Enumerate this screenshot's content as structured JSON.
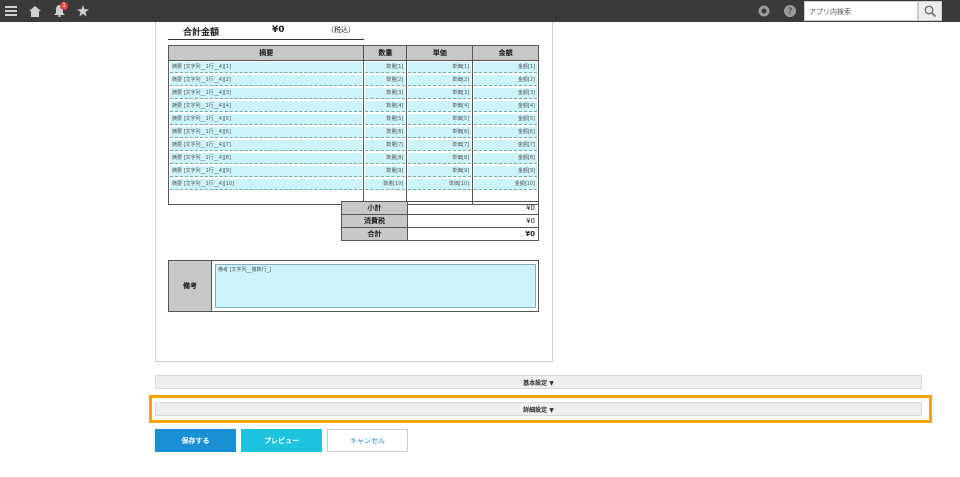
{
  "topbar": {
    "search_placeholder": "アプリ内検索",
    "notification_count": "1",
    "icons": [
      "menu-icon",
      "home-icon",
      "bell-icon",
      "star-icon",
      "gear-icon",
      "help-icon",
      "search-icon"
    ]
  },
  "form": {
    "total_label": "合計金額",
    "total_value": "¥0",
    "tax_included": "（税込）",
    "headers": [
      "摘要",
      "数量",
      "単価",
      "金額"
    ],
    "rows": [
      {
        "desc": "摘要 [文字列__1行__4][1]",
        "qty": "数量[1]",
        "price": "単価[1]",
        "amount": "金額[1]"
      },
      {
        "desc": "摘要 [文字列__1行__4][2]",
        "qty": "数量[2]",
        "price": "単価[2]",
        "amount": "金額[2]"
      },
      {
        "desc": "摘要 [文字列__1行__4][3]",
        "qty": "数量[3]",
        "price": "単価[3]",
        "amount": "金額[3]"
      },
      {
        "desc": "摘要 [文字列__1行__4][4]",
        "qty": "数量[4]",
        "price": "単価[4]",
        "amount": "金額[4]"
      },
      {
        "desc": "摘要 [文字列__1行__4][5]",
        "qty": "数量[5]",
        "price": "単価[5]",
        "amount": "金額[5]"
      },
      {
        "desc": "摘要 [文字列__1行__4][6]",
        "qty": "数量[6]",
        "price": "単価[6]",
        "amount": "金額[6]"
      },
      {
        "desc": "摘要 [文字列__1行__4][7]",
        "qty": "数量[7]",
        "price": "単価[7]",
        "amount": "金額[7]"
      },
      {
        "desc": "摘要 [文字列__1行__4][8]",
        "qty": "数量[8]",
        "price": "単価[8]",
        "amount": "金額[8]"
      },
      {
        "desc": "摘要 [文字列__1行__4][9]",
        "qty": "数量[9]",
        "price": "単価[9]",
        "amount": "金額[9]"
      },
      {
        "desc": "摘要 [文字列__1行__4][10]",
        "qty": "数量[10]",
        "price": "単価[10]",
        "amount": "金額[10]"
      }
    ],
    "subtotal_label": "小計",
    "subtotal_value": "¥0",
    "tax_label": "消費税",
    "tax_value": "¥0",
    "grand_label": "合計",
    "grand_value": "¥0",
    "notes_label": "備考",
    "notes_value": "備考 [文字列__複数行_]"
  },
  "sections": {
    "basic": "基本設定 ▼",
    "advanced": "詳細設定 ▼"
  },
  "buttons": {
    "save": "保存する",
    "preview": "プレビュー",
    "cancel": "キャンセル"
  },
  "colors": {
    "highlight": "#f4a300",
    "save_button": "#1b8fd3",
    "preview_button": "#1ec4dd",
    "input_fill": "#cdf3fb"
  }
}
